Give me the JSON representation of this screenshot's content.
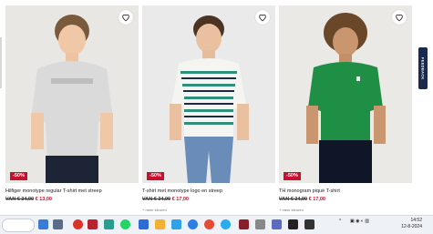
{
  "products": [
    {
      "name": "Hilfiger monotype regular T-shirt met streep",
      "discount": "-50%",
      "price_old": "VAN € 34,90",
      "price_new": "€ 13,00",
      "colors_text": ""
    },
    {
      "name": "T-shirt met monotype logo en streep",
      "discount": "-50%",
      "price_old": "VAN € 34,90",
      "price_new": "€ 17,00",
      "colors_text": "+ meer kleuren"
    },
    {
      "name": "TH monogram piqué T-shirt",
      "discount": "-50%",
      "price_old": "VAN € 34,90",
      "price_new": "€ 17,00",
      "colors_text": "+ meer kleuren"
    }
  ],
  "feedback_label": "FEEDBACK",
  "taskbar": {
    "time": "14:52",
    "date": "12-8-2024"
  },
  "icons": [
    "heart-icon",
    "windows-start-icon",
    "search-icon",
    "whatsapp-icon",
    "chrome-icon",
    "edge-icon",
    "telegram-icon",
    "wifi-icon",
    "volume-icon",
    "battery-icon"
  ],
  "colors": {
    "sale_red": "#c8102e",
    "feedback_navy": "#1a2a4f",
    "shirt_green": "#1f8f45"
  }
}
